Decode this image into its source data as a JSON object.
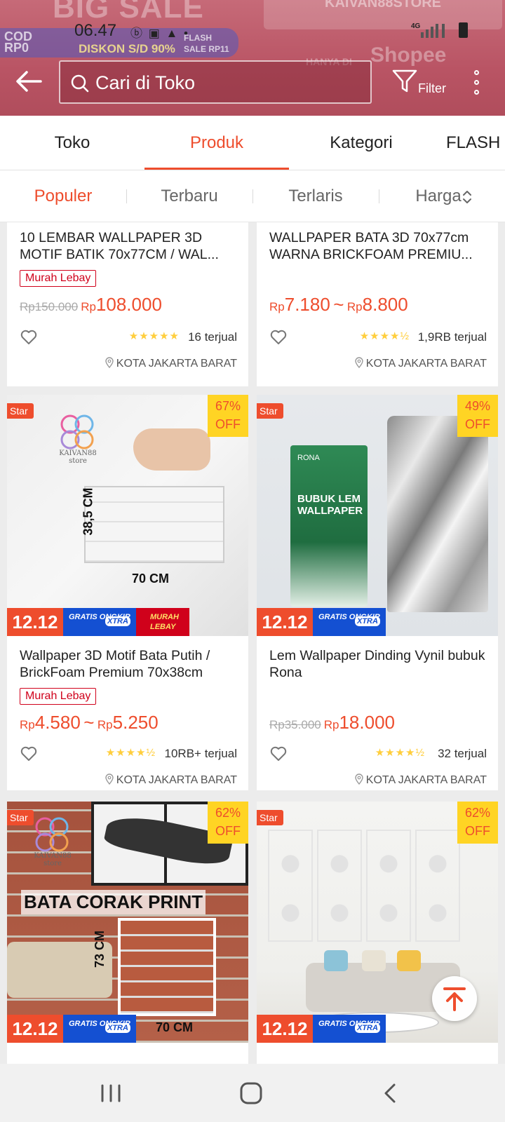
{
  "status_bar": {
    "time": "06.47",
    "icons": "ⓑ ▣ ▲ •",
    "network": "4G"
  },
  "banner": {
    "big_sale": "BIG SALE",
    "store": "KAIVAN88STORE",
    "cod": "COD",
    "cod_sub": "RP0",
    "diskon": "DISKON S/D 90%",
    "flash": "FLASH SALE RP11",
    "hanya": "HANYA DI",
    "shopee": "Shopee"
  },
  "header": {
    "search_placeholder": "Cari di Toko",
    "filter_label": "Filter"
  },
  "tabs": [
    {
      "label": "Toko"
    },
    {
      "label": "Produk"
    },
    {
      "label": "Kategori"
    },
    {
      "label": "FLASH"
    }
  ],
  "sort": {
    "populer": "Populer",
    "terbaru": "Terbaru",
    "terlaris": "Terlaris",
    "harga": "Harga"
  },
  "colors": {
    "accent": "#ee4d2d",
    "star": "#ffce3d",
    "tag": "#d0011b"
  },
  "products": [
    {
      "name": "10 LEMBAR WALLPAPER 3D MOTIF BATIK 70x77CM / WAL...",
      "tag": "Murah Lebay",
      "old_price": "Rp150.000",
      "currency": "Rp",
      "price": "108.000",
      "rating": 5,
      "sold": "16 terjual",
      "location": "KOTA JAKARTA BARAT"
    },
    {
      "name": "WALLPAPER BATA 3D 70x77cm WARNA BRICKFOAM PREMIU...",
      "currency": "Rp",
      "price_min": "7.180",
      "price_sep": "~",
      "price_max": "8.800",
      "rating": 4.5,
      "sold": "1,9RB terjual",
      "location": "KOTA JAKARTA BARAT"
    },
    {
      "badge": "Star",
      "discount": "67%",
      "off": "OFF",
      "promo_1212": "12.12",
      "gratis": "GRATIS ONGKIR",
      "xtra": "XTRA",
      "murah": "MURAH LEBAY",
      "logo_text": "KAIVAN88 store",
      "dim_v": "38,5 CM",
      "dim_h": "70 CM",
      "name": "Wallpaper 3D Motif Bata Putih / BrickFoam Premium 70x38cm",
      "tag": "Murah Lebay",
      "currency": "Rp",
      "price_min": "4.580",
      "price_sep": "~",
      "price_max": "5.250",
      "rating": 4.5,
      "sold": "10RB+ terjual",
      "location": "KOTA JAKARTA BARAT"
    },
    {
      "badge": "Star",
      "discount": "49%",
      "off": "OFF",
      "promo_1212": "12.12",
      "gratis": "GRATIS ONGKIR",
      "xtra": "XTRA",
      "box_brand": "RONA",
      "box_title": "BUBUK LEM WALLPAPER",
      "name": "Lem Wallpaper Dinding Vynil bubuk Rona",
      "old_price": "Rp35.000",
      "currency": "Rp",
      "price": "18.000",
      "rating": 4.5,
      "sold": "32 terjual",
      "location": "KOTA JAKARTA BARAT"
    },
    {
      "badge": "Star",
      "discount": "62%",
      "off": "OFF",
      "promo_1212": "12.12",
      "gratis": "GRATIS ONGKIR",
      "xtra": "XTRA",
      "logo_text": "KAIVAN88 store",
      "title": "BATA CORAK PRINT",
      "dim_v": "73 CM",
      "dim_h": "70 CM"
    },
    {
      "badge": "Star",
      "discount": "62%",
      "off": "OFF",
      "promo_1212": "12.12",
      "gratis": "GRATIS ONGKIR",
      "xtra": "XTRA"
    }
  ],
  "icons": [
    "back-arrow-icon",
    "search-icon",
    "filter-icon",
    "more-vertical-icon",
    "chevron-updown-icon",
    "heart-icon",
    "location-pin-icon",
    "arrow-up-icon",
    "recent-apps-icon",
    "home-icon",
    "back-icon"
  ]
}
